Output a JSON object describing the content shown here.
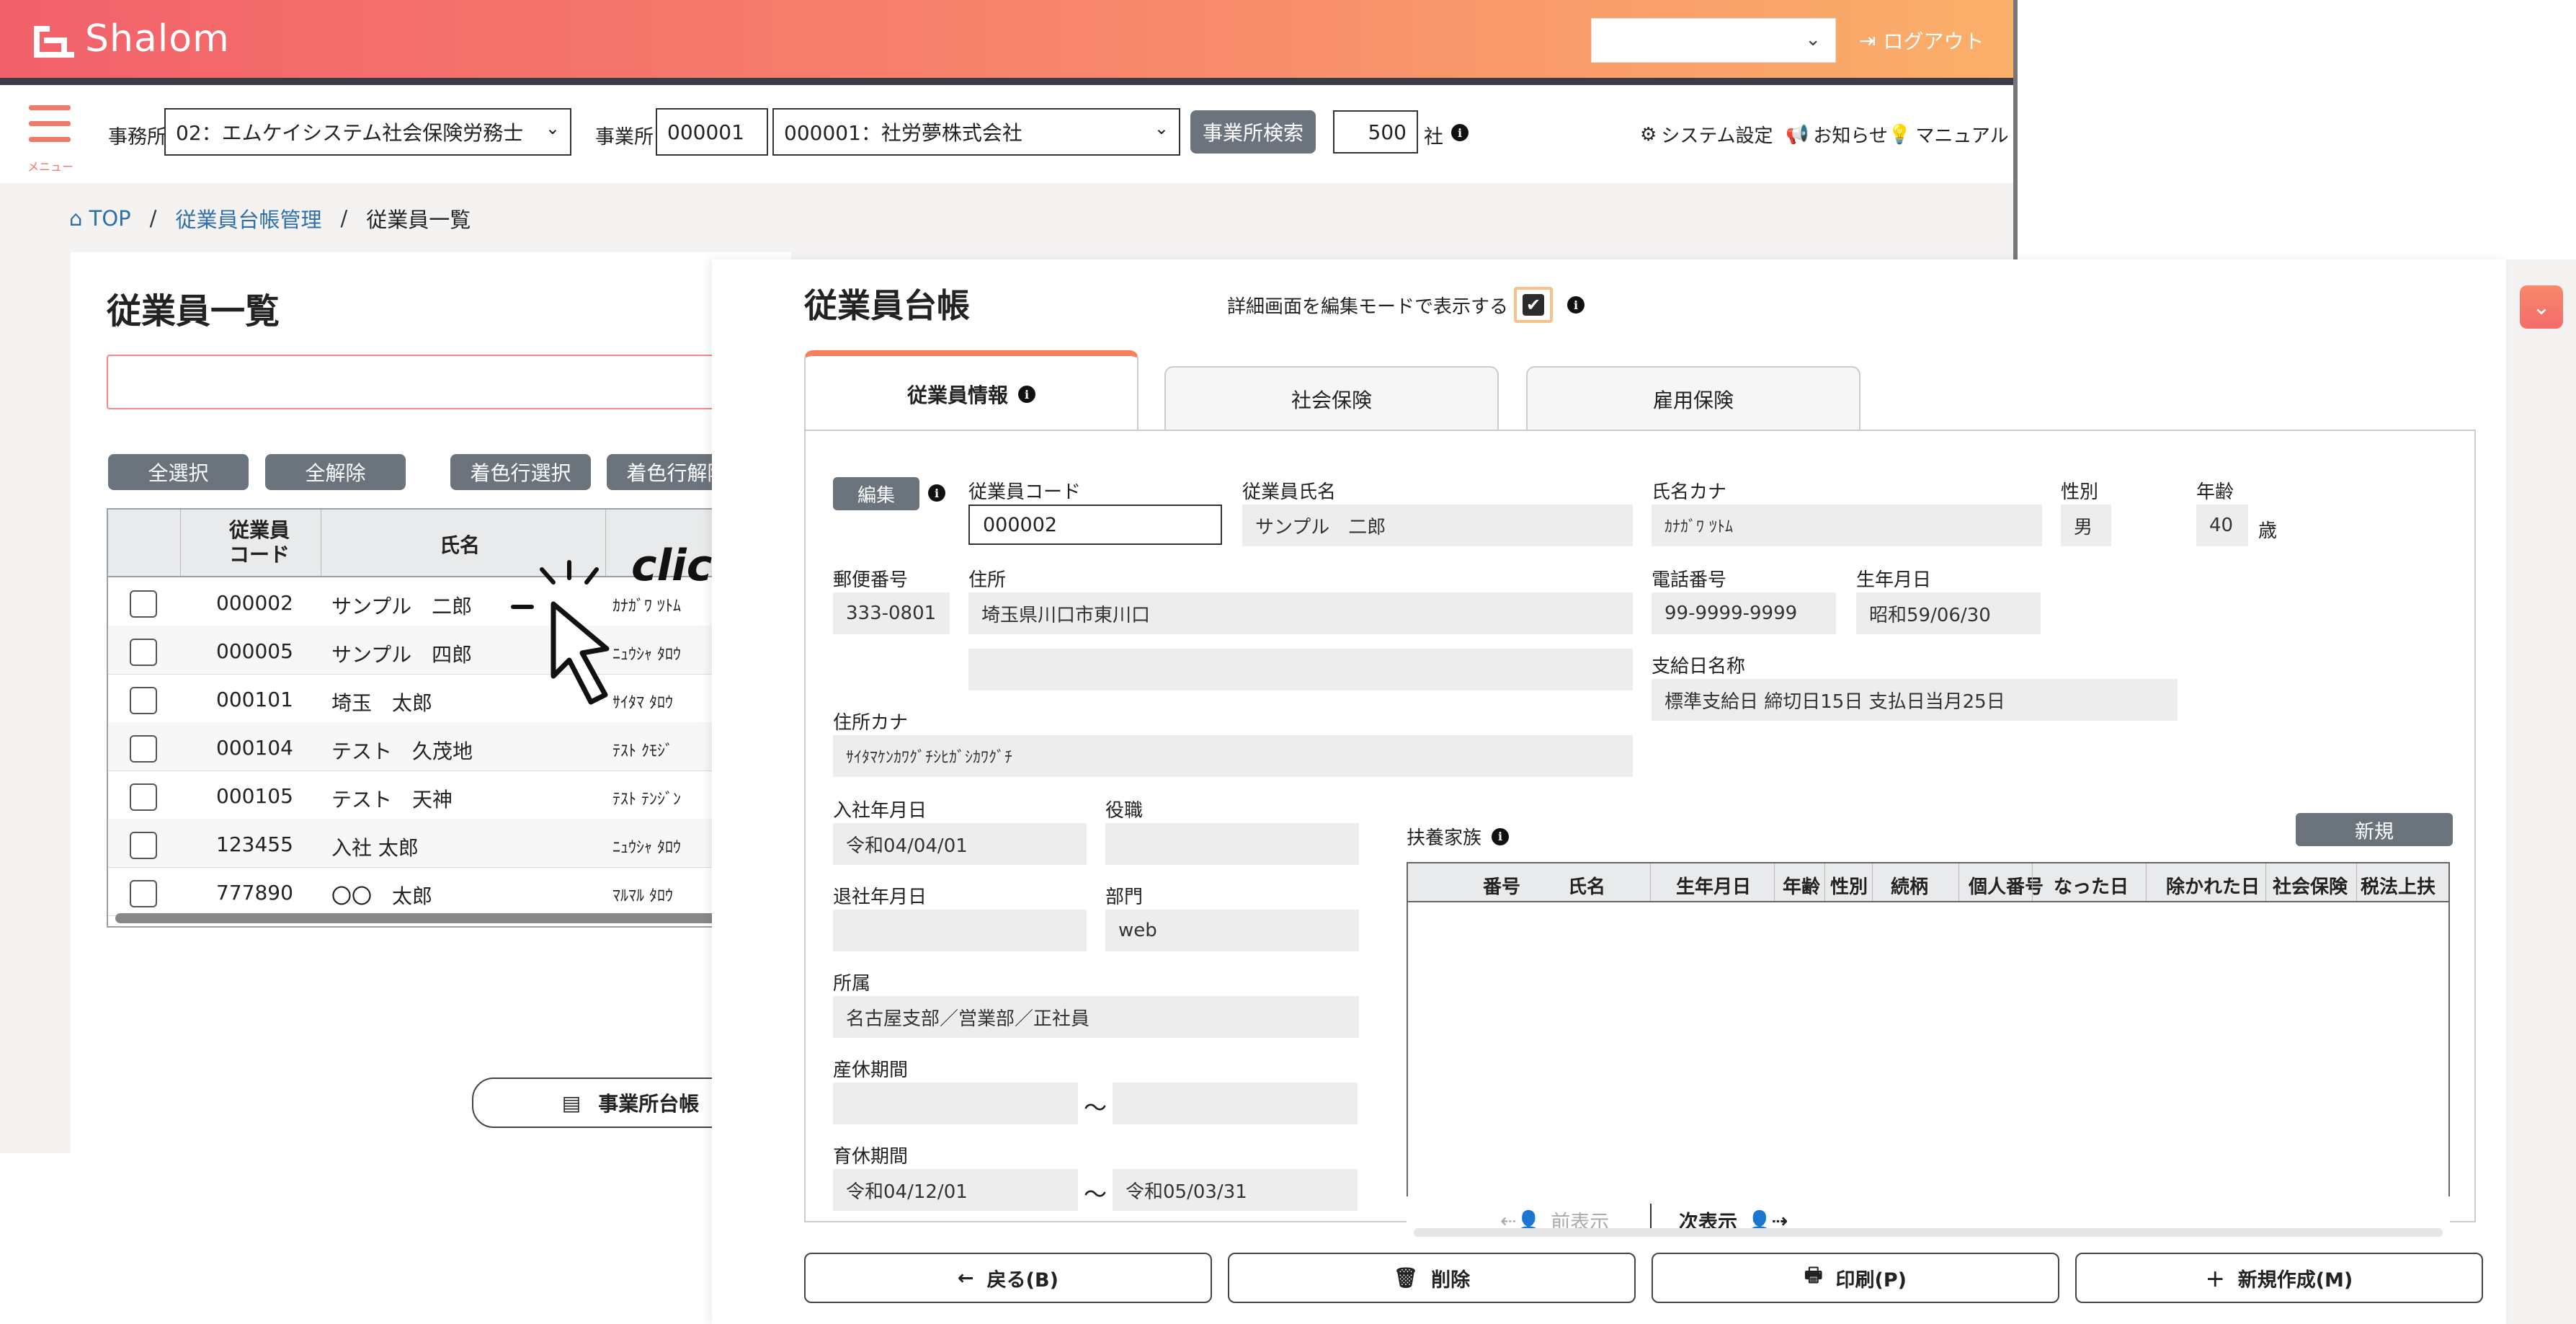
{
  "app": {
    "logo": "Shalom",
    "logout": "ログアウト",
    "top_select_value": ""
  },
  "toolbar": {
    "menu_label": "メニュー",
    "office_label": "事務所",
    "office_value": "02：エムケイシステム社会保険労務士",
    "jigyosho_label": "事業所",
    "jigyosho_code": "000001",
    "jigyosho_name": "000001：社労夢株式会社",
    "search_button": "事業所検索",
    "count": "500",
    "count_unit": "社",
    "system_settings": "システム設定",
    "notices": "お知らせ",
    "manual": "マニュアル"
  },
  "breadcrumb": {
    "top": "TOP",
    "sep": "/",
    "ledger": "従業員台帳管理",
    "current": "従業員一覧"
  },
  "employee_list": {
    "title": "従業員一覧",
    "buttons": [
      "全選択",
      "全解除",
      "着色行選択",
      "着色行解除"
    ],
    "col_code": "従業員\nコード",
    "col_name": "氏名",
    "rows": [
      {
        "code": "000002",
        "name": "サンプル　二郎",
        "kana": "ｶﾅｶﾞﾜ ﾂﾄﾑ"
      },
      {
        "code": "000005",
        "name": "サンプル　四郎",
        "kana": "ﾆｭｳｼｬ ﾀﾛｳ"
      },
      {
        "code": "000101",
        "name": "埼玉　太郎",
        "kana": "ｻｲﾀﾏ ﾀﾛｳ"
      },
      {
        "code": "000104",
        "name": "テスト　久茂地",
        "kana": "ﾃｽﾄ ｸﾓｼﾞ"
      },
      {
        "code": "000105",
        "name": "テスト　天神",
        "kana": "ﾃｽﾄ ﾃﾝｼﾞﾝ"
      },
      {
        "code": "123455",
        "name": "入社 太郎",
        "kana": "ﾆｭｳｼｬ ﾀﾛｳ"
      },
      {
        "code": "777890",
        "name": "〇〇　太郎",
        "kana": "ﾏﾙﾏﾙ ﾀﾛｳ"
      }
    ],
    "office_ledger_button": "事業所台帳",
    "click_text": "click"
  },
  "modal": {
    "title": "従業員台帳",
    "edit_mode_label": "詳細画面を編集モードで表示する",
    "tabs": [
      "従業員情報",
      "社会保険",
      "雇用保険"
    ],
    "edit_button": "編集",
    "fields": {
      "employee_code": {
        "label": "従業員コード",
        "value": "000002"
      },
      "employee_name": {
        "label": "従業員氏名",
        "value": "サンプル　二郎"
      },
      "name_kana": {
        "label": "氏名カナ",
        "value": "ｶﾅｶﾞﾜ ﾂﾄﾑ"
      },
      "gender": {
        "label": "性別",
        "value": "男"
      },
      "age": {
        "label": "年齢",
        "value": "40",
        "unit": "歳"
      },
      "postal": {
        "label": "郵便番号",
        "value": "333-0801"
      },
      "address": {
        "label": "住所",
        "value": "埼玉県川口市東川口",
        "value2": ""
      },
      "phone": {
        "label": "電話番号",
        "value": "99-9999-9999"
      },
      "birth": {
        "label": "生年月日",
        "value": "昭和59/06/30"
      },
      "payday": {
        "label": "支給日名称",
        "value": "標準支給日 締切日15日 支払日当月25日"
      },
      "address_kana": {
        "label": "住所カナ",
        "value": "ｻｲﾀﾏｹﾝｶﾜｸﾞﾁｼﾋｶﾞｼｶﾜｸﾞﾁ"
      },
      "join_date": {
        "label": "入社年月日",
        "value": "令和04/04/01"
      },
      "position": {
        "label": "役職",
        "value": ""
      },
      "leave_date": {
        "label": "退社年月日",
        "value": ""
      },
      "department": {
        "label": "部門",
        "value": "web"
      },
      "affiliation": {
        "label": "所属",
        "value": "名古屋支部／営業部／正社員"
      },
      "maternity": {
        "label": "産休期間",
        "from": "",
        "to": "",
        "sep": "～"
      },
      "childcare": {
        "label": "育休期間",
        "from": "令和04/12/01",
        "to": "令和05/03/31",
        "sep": "～"
      }
    },
    "dependents": {
      "label": "扶養家族",
      "new_button": "新規",
      "columns": [
        "番号",
        "氏名",
        "生年月日",
        "年齢",
        "性別",
        "続柄",
        "個人番号",
        "なった日",
        "除かれた日",
        "社会保険",
        "税法上扶"
      ],
      "prev": "前表示",
      "next": "次表示"
    },
    "bottom_buttons": {
      "back": "戻る(B)",
      "delete": "削除",
      "print": "印刷(P)",
      "new": "新規作成(M)"
    }
  },
  "colors": {
    "header_start": "#f2616b",
    "header_end": "#fbb06a",
    "accent": "#f6805c",
    "gray_button": "#6b747c",
    "link": "#2f6fa8"
  }
}
